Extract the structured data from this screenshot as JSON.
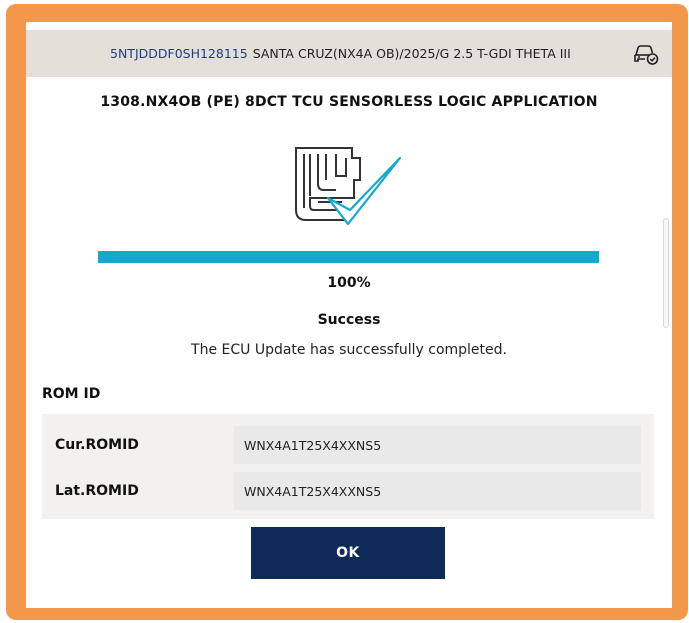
{
  "header": {
    "vin": "5NTJDDDF0SH128115",
    "vehicle": "SANTA CRUZ(NX4A OB)/2025/G 2.5 T-GDI THETA III",
    "vehicle_icon": "car-check-icon"
  },
  "dialog": {
    "title": "1308.NX4OB (PE) 8DCT TCU SENSORLESS LOGIC APPLICATION",
    "graphic_icon": "ecu-check-icon"
  },
  "progress": {
    "value": 100,
    "label": "100%",
    "color": "#13a9cf"
  },
  "result": {
    "status": "Success",
    "message": "The ECU Update has successfully completed."
  },
  "rom": {
    "heading": "ROM ID",
    "rows": [
      {
        "label": "Cur.ROMID",
        "value": "WNX4A1T25X4XXNS5"
      },
      {
        "label": "Lat.ROMID",
        "value": "WNX4A1T25X4XXNS5"
      }
    ]
  },
  "actions": {
    "ok_label": "OK"
  },
  "colors": {
    "frame": "#f3984a",
    "header_bg": "#e5dfd9",
    "button": "#0e2a57",
    "vin_text": "#1d3e8a"
  }
}
